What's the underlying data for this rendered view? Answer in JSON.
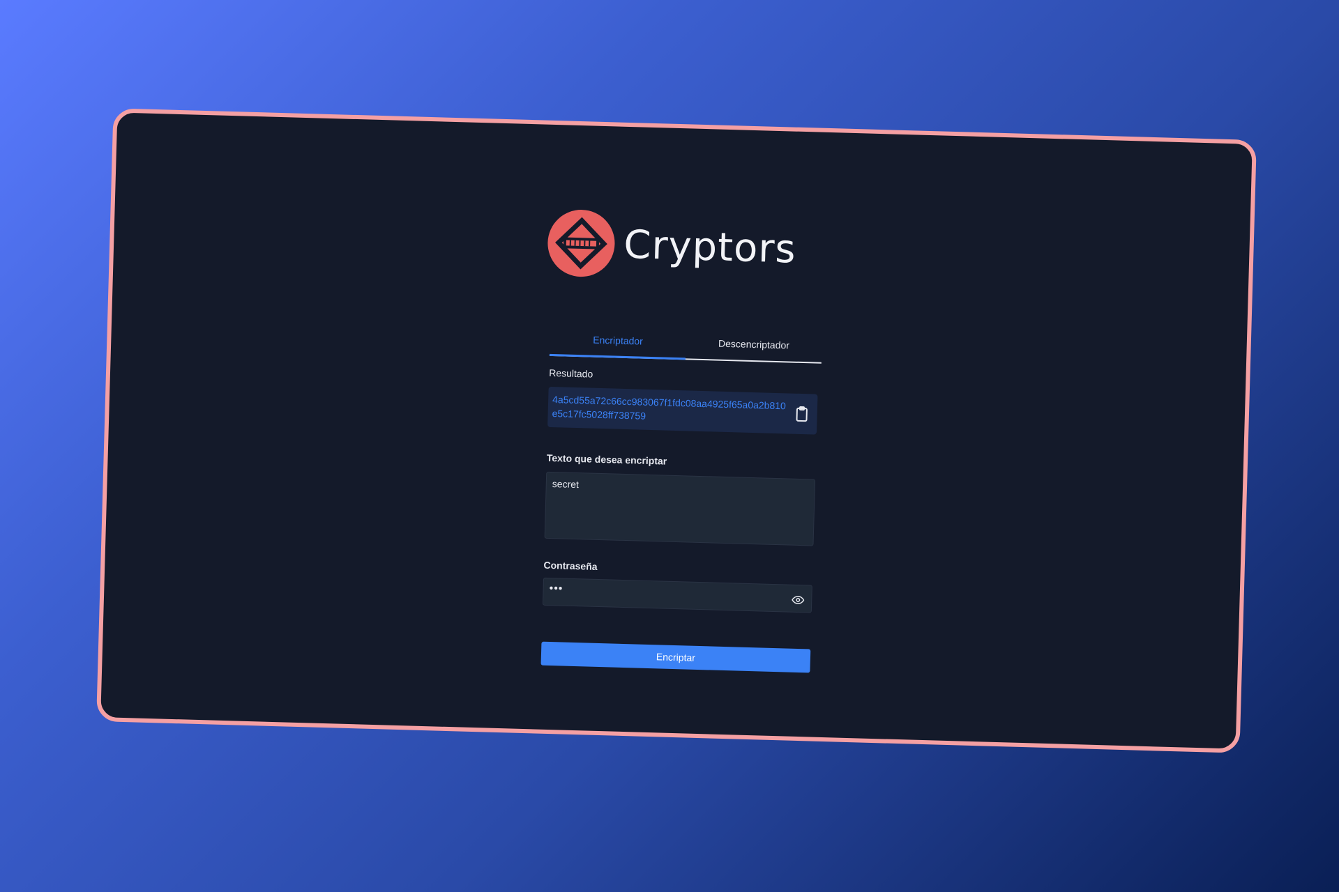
{
  "app": {
    "title": "Cryptors",
    "logo_icon": "cryptors-logo-icon"
  },
  "tabs": [
    {
      "label": "Encriptador",
      "active": true
    },
    {
      "label": "Descencriptador",
      "active": false
    }
  ],
  "result": {
    "label": "Resultado",
    "value": "4a5cd55a72c66cc983067f1fdc08aa4925f65a0a2b810e5c17fc5028ff738759",
    "copy_icon": "clipboard-icon"
  },
  "text_input": {
    "label": "Texto que desea encriptar",
    "value": "secret"
  },
  "password": {
    "label": "Contraseña",
    "value": "•••",
    "toggle_icon": "eye-icon"
  },
  "submit": {
    "label": "Encriptar"
  },
  "colors": {
    "accent": "#3b82f6",
    "brand": "#e8605f",
    "frame_border": "#f5a0a3",
    "panel_bg": "#141a2a"
  }
}
